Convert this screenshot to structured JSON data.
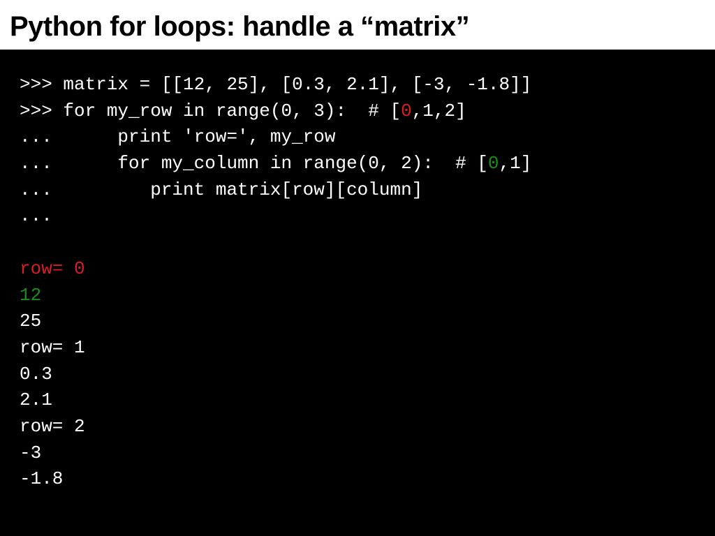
{
  "title": "Python for loops: handle a “matrix”",
  "code": {
    "l1": ">>> matrix = [[12, 25], [0.3, 2.1], [-3, -1.8]]",
    "l2a": ">>> for my_row in range(0, 3):  # [",
    "l2b": "0",
    "l2c": ",1,2]",
    "l3": "...      print 'row=', my_row",
    "l4a": "...      for my_column in range(0, 2):  # [",
    "l4b": "0",
    "l4c": ",1]",
    "l5": "...         print matrix[row][column]",
    "l6": "...",
    "blank": "",
    "o1": "row= 0",
    "o2": "12",
    "o3": "25",
    "o4": "row= 1",
    "o5": "0.3",
    "o6": "2.1",
    "o7": "row= 2",
    "o8": "-3",
    "o9": "-1.8"
  }
}
